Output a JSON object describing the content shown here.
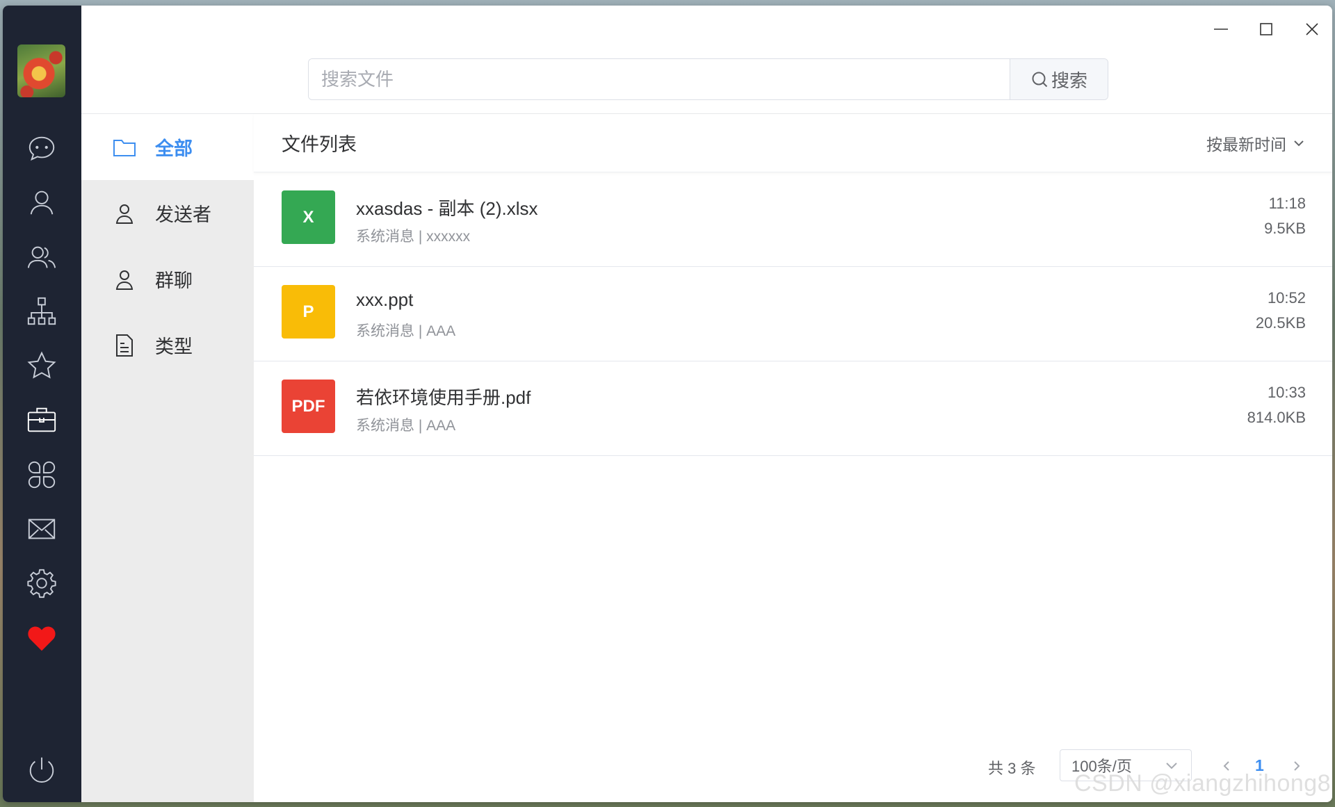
{
  "search": {
    "placeholder": "搜索文件",
    "button_label": "搜索"
  },
  "categories": [
    {
      "label": "全部",
      "icon": "folder-icon",
      "active": true
    },
    {
      "label": "发送者",
      "icon": "user-icon",
      "active": false
    },
    {
      "label": "群聊",
      "icon": "user-icon",
      "active": false
    },
    {
      "label": "类型",
      "icon": "document-icon",
      "active": false
    }
  ],
  "list": {
    "title": "文件列表",
    "sort_label": "按最新时间",
    "files": [
      {
        "badge": "X",
        "badge_color": "#34a853",
        "name": "xxasdas - 副本 (2).xlsx",
        "meta": "系统消息 | xxxxxx",
        "time": "11:18",
        "size": "9.5KB"
      },
      {
        "badge": "P",
        "badge_color": "#f9bc07",
        "name": "xxx.ppt",
        "meta": "系统消息 | AAA",
        "time": "10:52",
        "size": "20.5KB"
      },
      {
        "badge": "PDF",
        "badge_color": "#ea4335",
        "name": "若依环境使用手册.pdf",
        "meta": "系统消息 | AAA",
        "time": "10:33",
        "size": "814.0KB"
      }
    ]
  },
  "pagination": {
    "total_label": "共 3 条",
    "page_size": "100条/页",
    "current_page": "1"
  },
  "watermark": "CSDN @xiangzhihong8",
  "rail_icons": [
    "chat-icon",
    "user-icon",
    "group-icon",
    "org-chart-icon",
    "star-icon",
    "briefcase-icon",
    "apps-icon",
    "mail-icon",
    "settings-icon",
    "heart-icon",
    "power-icon"
  ],
  "colors": {
    "accent": "#3d8ef0",
    "rail": "#1e2433",
    "heart": "#f21818"
  }
}
